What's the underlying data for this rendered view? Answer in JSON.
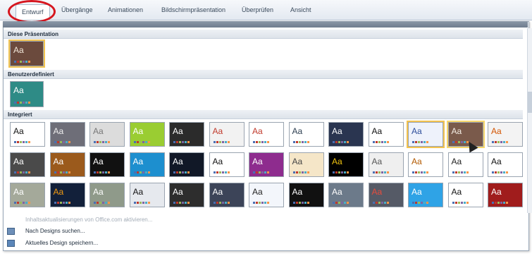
{
  "ribbon": {
    "tabs": [
      "Entwurf",
      "Übergänge",
      "Animationen",
      "Bildschirmpräsentation",
      "Überprüfen",
      "Ansicht"
    ],
    "active_tab": "Entwurf",
    "highlight_color": "#d6161f"
  },
  "gallery": {
    "sections": [
      {
        "title": "Diese Präsentation"
      },
      {
        "title": "Benutzerdefiniert"
      },
      {
        "title": "Integriert"
      }
    ],
    "thumb_label": "Aa",
    "this_presentation_theme": {
      "bg": "#6b4a3d",
      "fg": "#f0e6d8"
    },
    "custom_theme": {
      "bg": "#2e8b86",
      "fg": "#ffffff"
    },
    "themes_row1": [
      {
        "bg": "#ffffff",
        "fg": "#111111"
      },
      {
        "bg": "#6e6e78",
        "fg": "#eeeeee"
      },
      {
        "bg": "#dcdcdc",
        "fg": "#777777"
      },
      {
        "bg": "#9acd32",
        "fg": "#ffffff"
      },
      {
        "bg": "#2b2b2b",
        "fg": "#ffffff"
      },
      {
        "bg": "#f2f2f2",
        "fg": "#c0392b"
      },
      {
        "bg": "#ffffff",
        "fg": "#c0392b"
      },
      {
        "bg": "#ffffff",
        "fg": "#2c3e50"
      },
      {
        "bg": "#2a3550",
        "fg": "#ffffff"
      },
      {
        "bg": "#ffffff",
        "fg": "#111111"
      },
      {
        "bg": "#eef2fb",
        "fg": "#2c4d9a"
      },
      {
        "bg": "#7a5a4b",
        "fg": "#f5eee5"
      },
      {
        "bg": "#f3f3f3",
        "fg": "#d35400"
      }
    ],
    "themes_row2": [
      {
        "bg": "#4a4a4a",
        "fg": "#ffffff"
      },
      {
        "bg": "#9b5a1c",
        "fg": "#ffffff"
      },
      {
        "bg": "#111111",
        "fg": "#ffffff"
      },
      {
        "bg": "#1d8fcf",
        "fg": "#ffffff"
      },
      {
        "bg": "#111827",
        "fg": "#ffffff"
      },
      {
        "bg": "#ffffff",
        "fg": "#111111"
      },
      {
        "bg": "#8e2c8e",
        "fg": "#ffffff"
      },
      {
        "bg": "#f5e6c8",
        "fg": "#444444"
      },
      {
        "bg": "#000000",
        "fg": "#f1c40f"
      },
      {
        "bg": "#efefef",
        "fg": "#555555"
      },
      {
        "bg": "#ffffff",
        "fg": "#b35a00"
      },
      {
        "bg": "#ffffff",
        "fg": "#222222"
      },
      {
        "bg": "#ffffff",
        "fg": "#111111"
      }
    ],
    "themes_row3": [
      {
        "bg": "#a4a99a",
        "fg": "#ffffff"
      },
      {
        "bg": "#12203a",
        "fg": "#f39c12"
      },
      {
        "bg": "#8f9a8a",
        "fg": "#ffffff"
      },
      {
        "bg": "#e6e9ee",
        "fg": "#111111"
      },
      {
        "bg": "#2d2d2d",
        "fg": "#ffffff"
      },
      {
        "bg": "#3c4458",
        "fg": "#ffffff"
      },
      {
        "bg": "#f3f6fb",
        "fg": "#222222"
      },
      {
        "bg": "#111111",
        "fg": "#ffffff"
      },
      {
        "bg": "#6c7a8a",
        "fg": "#ffffff"
      },
      {
        "bg": "#555a66",
        "fg": "#e74c3c"
      },
      {
        "bg": "#2fa3e6",
        "fg": "#ffffff"
      },
      {
        "bg": "#ffffff",
        "fg": "#111111"
      },
      {
        "bg": "#a01c1c",
        "fg": "#ffffff"
      }
    ],
    "swatches": [
      "#4a6fb3",
      "#c0392b",
      "#9bbb59",
      "#8064a2",
      "#4bacc6",
      "#f79646"
    ]
  },
  "menu": {
    "items": [
      {
        "label": "Inhaltsaktualisierungen von Office.com aktivieren...",
        "enabled": false
      },
      {
        "label": "Nach Designs suchen...",
        "enabled": true
      },
      {
        "label": "Aktuelles Design speichern...",
        "enabled": true
      }
    ]
  }
}
